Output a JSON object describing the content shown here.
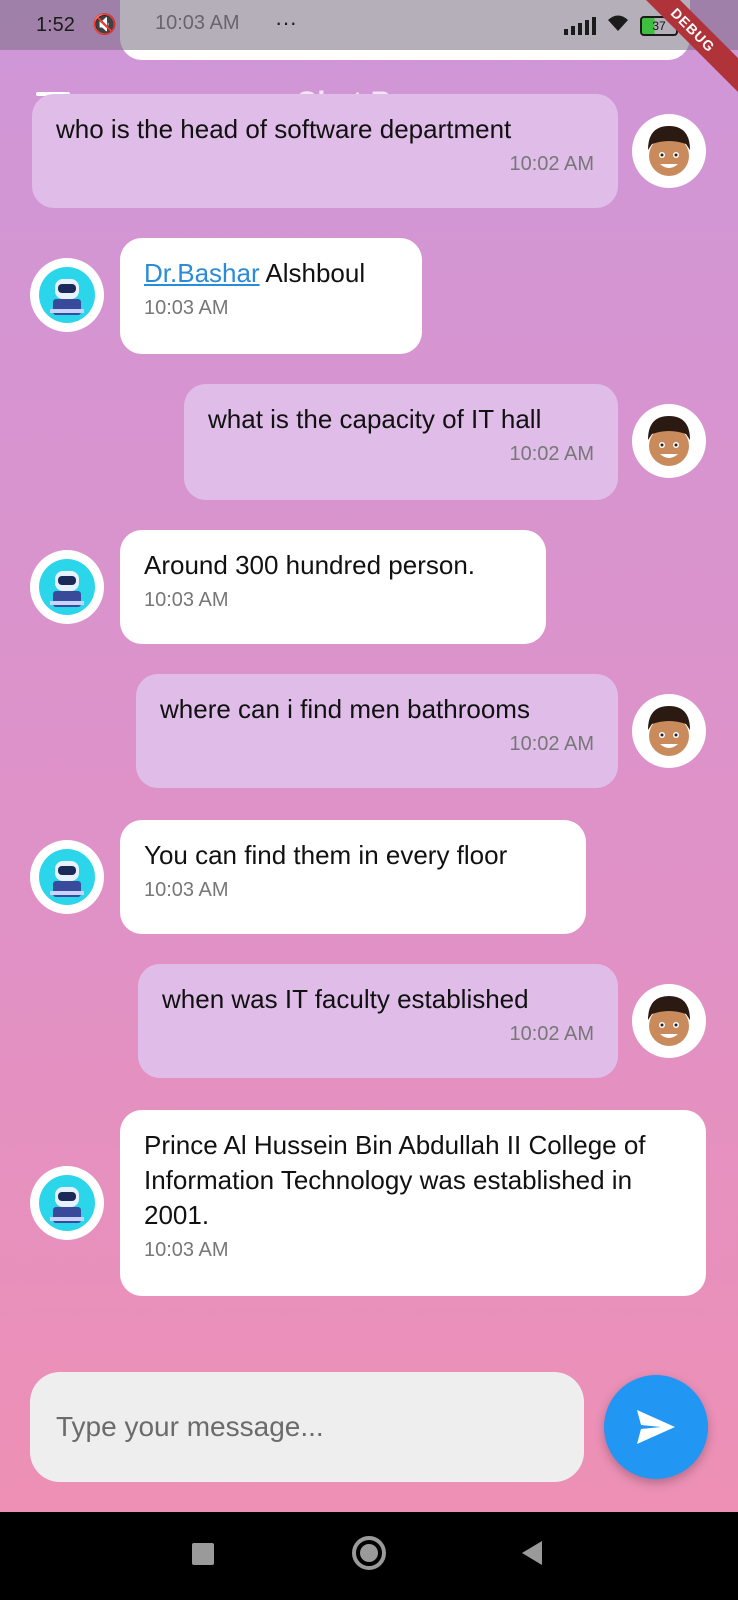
{
  "status_bar": {
    "time": "1:52",
    "overlay_time": "10:03 AM",
    "more_dots": "···",
    "battery": "37"
  },
  "debug_banner": "DEBUG",
  "header": {
    "title": "Chat Page"
  },
  "messages": [
    {
      "sender": "user",
      "text": "who is the head of software department",
      "time": "10:02 AM"
    },
    {
      "sender": "bot",
      "link_text": "Dr.Bashar",
      "text": " Alshboul",
      "time": "10:03 AM"
    },
    {
      "sender": "user",
      "text": "what is the capacity of IT hall",
      "time": "10:02 AM"
    },
    {
      "sender": "bot",
      "text": "Around 300 hundred person.",
      "time": "10:03 AM"
    },
    {
      "sender": "user",
      "text": "where can i find men bathrooms",
      "time": "10:02 AM"
    },
    {
      "sender": "bot",
      "text": "You can find them in every floor",
      "time": "10:03 AM"
    },
    {
      "sender": "user",
      "text": "when was IT faculty established",
      "time": "10:02 AM"
    },
    {
      "sender": "bot",
      "text": "Prince Al Hussein Bin Abdullah II College of Information Technology was established in 2001.",
      "time": "10:03 AM"
    }
  ],
  "composer": {
    "placeholder": "Type your message..."
  },
  "colors": {
    "user_bubble": "#dfbde8",
    "bot_bubble": "#ffffff",
    "send_button": "#2196f3"
  }
}
